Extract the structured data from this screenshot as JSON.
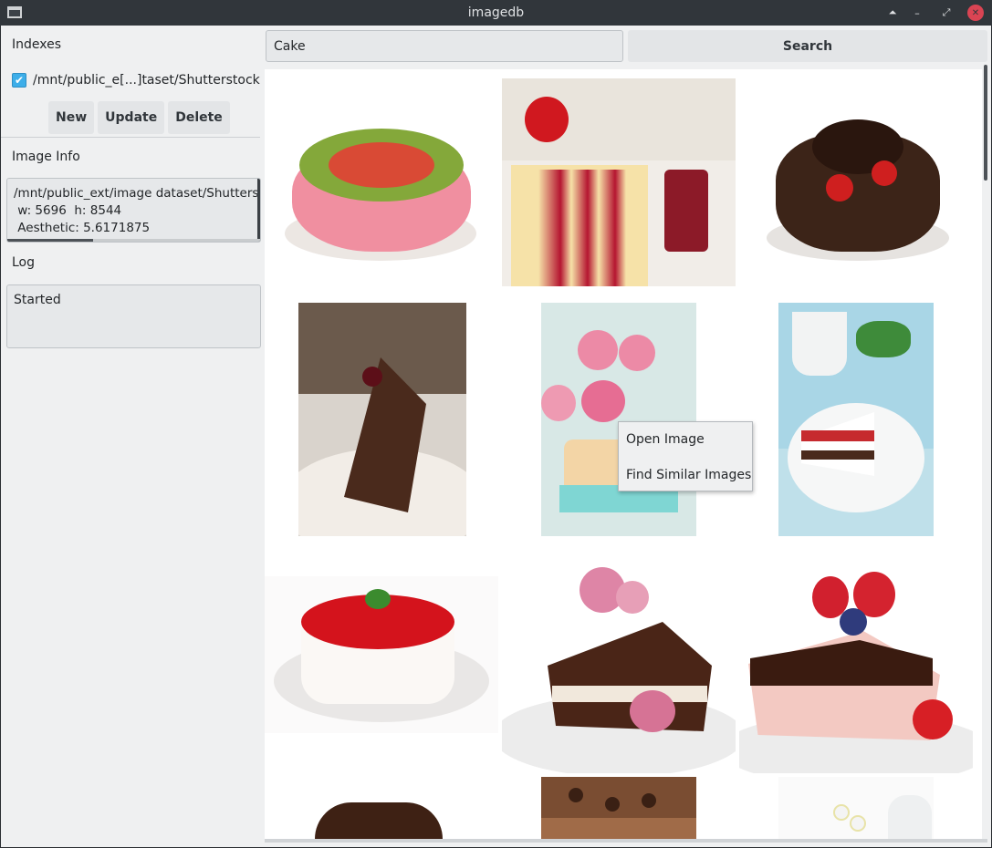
{
  "window": {
    "title": "imagedb"
  },
  "indexes": {
    "label": "Indexes",
    "items": [
      {
        "path": "/mnt/public_e[...]taset/Shutterstock",
        "checked": true
      }
    ],
    "buttons": {
      "new": "New",
      "update": "Update",
      "delete": "Delete"
    }
  },
  "image_info": {
    "label": "Image Info",
    "path": "/mnt/public_ext/image dataset/Shutterstc",
    "dims": " w: 5696  h: 8544",
    "aesthetic": " Aesthetic: 5.6171875"
  },
  "log": {
    "label": "Log",
    "text": "Started"
  },
  "search": {
    "value": "Cake",
    "button_label": "Search"
  },
  "context_menu": {
    "items": [
      "Open Image",
      "Find Similar Images"
    ]
  },
  "colors": {
    "titlebar": "#31363b",
    "accent": "#3daee9",
    "close": "#da4453",
    "window_bg": "#eff0f1"
  }
}
